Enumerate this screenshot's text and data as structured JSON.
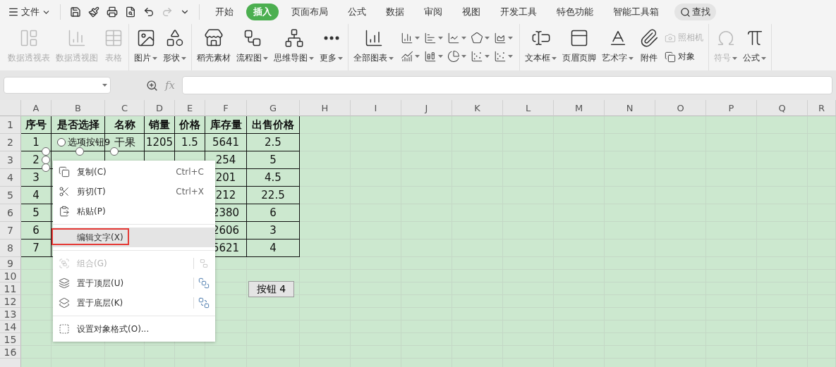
{
  "title_bar": {
    "file_menu": "文件"
  },
  "tabs": [
    {
      "label": "开始",
      "selected": false
    },
    {
      "label": "插入",
      "selected": true
    },
    {
      "label": "页面布局",
      "selected": false
    },
    {
      "label": "公式",
      "selected": false
    },
    {
      "label": "数据",
      "selected": false
    },
    {
      "label": "审阅",
      "selected": false
    },
    {
      "label": "视图",
      "selected": false
    },
    {
      "label": "开发工具",
      "selected": false
    },
    {
      "label": "特色功能",
      "selected": false
    },
    {
      "label": "智能工具箱",
      "selected": false
    }
  ],
  "search": {
    "label": "查找"
  },
  "ribbon": {
    "groups": [
      [
        {
          "kind": "large",
          "label": "数据透视表",
          "disabled": true,
          "dropdown": false
        },
        {
          "kind": "large",
          "label": "数据透视图",
          "disabled": true,
          "dropdown": false
        },
        {
          "kind": "large",
          "label": "表格",
          "disabled": true,
          "dropdown": false
        }
      ],
      [
        {
          "kind": "large",
          "label": "图片",
          "disabled": false,
          "dropdown": true
        },
        {
          "kind": "large",
          "label": "形状",
          "disabled": false,
          "dropdown": true
        }
      ],
      [
        {
          "kind": "large",
          "label": "稻壳素材",
          "disabled": false,
          "dropdown": false
        },
        {
          "kind": "large",
          "label": "流程图",
          "disabled": false,
          "dropdown": true
        },
        {
          "kind": "large",
          "label": "思维导图",
          "disabled": false,
          "dropdown": true
        },
        {
          "kind": "large",
          "label": "更多",
          "disabled": false,
          "dropdown": true
        }
      ],
      [
        {
          "kind": "large",
          "label": "全部图表",
          "disabled": false,
          "dropdown": true
        },
        {
          "kind": "chart_grid"
        }
      ],
      [
        {
          "kind": "large",
          "label": "文本框",
          "disabled": false,
          "dropdown": true
        },
        {
          "kind": "large",
          "label": "页眉页脚",
          "disabled": false,
          "dropdown": false
        },
        {
          "kind": "large",
          "label": "艺术字",
          "disabled": false,
          "dropdown": true
        },
        {
          "kind": "large",
          "label": "附件",
          "disabled": false,
          "dropdown": false
        },
        {
          "kind": "small",
          "label": "照相机",
          "disabled": true,
          "dropdown": false
        },
        {
          "kind": "small",
          "label": "对象",
          "disabled": false,
          "dropdown": false
        }
      ],
      [
        {
          "kind": "large",
          "label": "符号",
          "disabled": true,
          "dropdown": true
        },
        {
          "kind": "large",
          "label": "公式",
          "disabled": false,
          "dropdown": true
        }
      ]
    ]
  },
  "formula_bar": {
    "fx": "fx"
  },
  "sheet": {
    "columns": [
      "A",
      "B",
      "C",
      "D",
      "E",
      "F",
      "G",
      "H",
      "I",
      "J",
      "K",
      "L",
      "M",
      "N",
      "O",
      "P",
      "Q",
      "R"
    ],
    "rows": [
      {
        "number": "1",
        "cells": [
          {
            "kind": "text",
            "text": "序号",
            "bold": true
          },
          {
            "kind": "text",
            "text": "是否选择",
            "bold": true
          },
          {
            "kind": "text",
            "text": "名称",
            "bold": true
          },
          {
            "kind": "text",
            "text": "销量",
            "bold": true
          },
          {
            "kind": "text",
            "text": "价格",
            "bold": true
          },
          {
            "kind": "text",
            "text": "库存量",
            "bold": true
          },
          {
            "kind": "text",
            "text": "出售价格",
            "bold": true
          }
        ]
      },
      {
        "number": "2",
        "cells": [
          {
            "kind": "text",
            "text": "1",
            "bold": false
          },
          {
            "kind": "radio",
            "label": "选项按钮9",
            "selected": false
          },
          {
            "kind": "text",
            "text": "干果",
            "bold": false
          },
          {
            "kind": "text",
            "text": "1205",
            "bold": false
          },
          {
            "kind": "text",
            "text": "1.5",
            "bold": false
          },
          {
            "kind": "text",
            "text": "5641",
            "bold": false
          },
          {
            "kind": "text",
            "text": "2.5",
            "bold": false
          }
        ]
      },
      {
        "number": "3",
        "cells": [
          {
            "kind": "text",
            "text": "2",
            "bold": false
          },
          {
            "kind": "empty"
          },
          {
            "kind": "empty"
          },
          {
            "kind": "empty"
          },
          {
            "kind": "empty"
          },
          {
            "kind": "text",
            "text": "254",
            "bold": false
          },
          {
            "kind": "text",
            "text": "5",
            "bold": false
          }
        ]
      },
      {
        "number": "4",
        "cells": [
          {
            "kind": "text",
            "text": "3",
            "bold": false
          },
          {
            "kind": "empty"
          },
          {
            "kind": "empty"
          },
          {
            "kind": "empty"
          },
          {
            "kind": "empty"
          },
          {
            "kind": "text",
            "text": "201",
            "bold": false
          },
          {
            "kind": "text",
            "text": "4.5",
            "bold": false
          }
        ]
      },
      {
        "number": "5",
        "cells": [
          {
            "kind": "text",
            "text": "4",
            "bold": false
          },
          {
            "kind": "empty"
          },
          {
            "kind": "empty"
          },
          {
            "kind": "empty"
          },
          {
            "kind": "empty"
          },
          {
            "kind": "text",
            "text": "212",
            "bold": false
          },
          {
            "kind": "text",
            "text": "22.5",
            "bold": false
          }
        ]
      },
      {
        "number": "6",
        "cells": [
          {
            "kind": "text",
            "text": "5",
            "bold": false
          },
          {
            "kind": "empty"
          },
          {
            "kind": "empty"
          },
          {
            "kind": "empty"
          },
          {
            "kind": "empty"
          },
          {
            "kind": "text",
            "text": "2380",
            "bold": false
          },
          {
            "kind": "text",
            "text": "6",
            "bold": false
          }
        ]
      },
      {
        "number": "7",
        "cells": [
          {
            "kind": "text",
            "text": "6",
            "bold": false
          },
          {
            "kind": "empty"
          },
          {
            "kind": "empty"
          },
          {
            "kind": "empty"
          },
          {
            "kind": "empty"
          },
          {
            "kind": "text",
            "text": "2606",
            "bold": false
          },
          {
            "kind": "text",
            "text": "3",
            "bold": false
          }
        ]
      },
      {
        "number": "8",
        "cells": [
          {
            "kind": "text",
            "text": "7",
            "bold": false
          },
          {
            "kind": "empty"
          },
          {
            "kind": "empty"
          },
          {
            "kind": "empty"
          },
          {
            "kind": "empty"
          },
          {
            "kind": "text",
            "text": "5621",
            "bold": false
          },
          {
            "kind": "text",
            "text": "4",
            "bold": false
          }
        ]
      }
    ],
    "more_rows": [
      "9",
      "10",
      "11",
      "12",
      "13",
      "14",
      "15",
      "16"
    ],
    "form_button": {
      "label": "按钮 4"
    }
  },
  "context_menu": {
    "items": [
      {
        "kind": "item",
        "label": "复制(C)",
        "shortcut": "Ctrl+C",
        "disabled": false,
        "highlighted": false
      },
      {
        "kind": "item",
        "label": "剪切(T)",
        "shortcut": "Ctrl+X",
        "disabled": false,
        "highlighted": false
      },
      {
        "kind": "item",
        "label": "粘贴(P)",
        "disabled": false,
        "highlighted": false
      },
      {
        "kind": "divider"
      },
      {
        "kind": "item",
        "label": "编辑文字(X)",
        "disabled": false,
        "highlighted": true
      },
      {
        "kind": "divider"
      },
      {
        "kind": "item",
        "label": "组合(G)",
        "disabled": true,
        "highlighted": false,
        "side_icon": true
      },
      {
        "kind": "item",
        "label": "置于顶层(U)",
        "disabled": false,
        "highlighted": false,
        "side_icon": true
      },
      {
        "kind": "item",
        "label": "置于底层(K)",
        "disabled": false,
        "highlighted": false,
        "side_icon": true
      },
      {
        "kind": "divider"
      },
      {
        "kind": "item",
        "label": "设置对象格式(O)...",
        "disabled": false,
        "highlighted": false
      }
    ]
  }
}
